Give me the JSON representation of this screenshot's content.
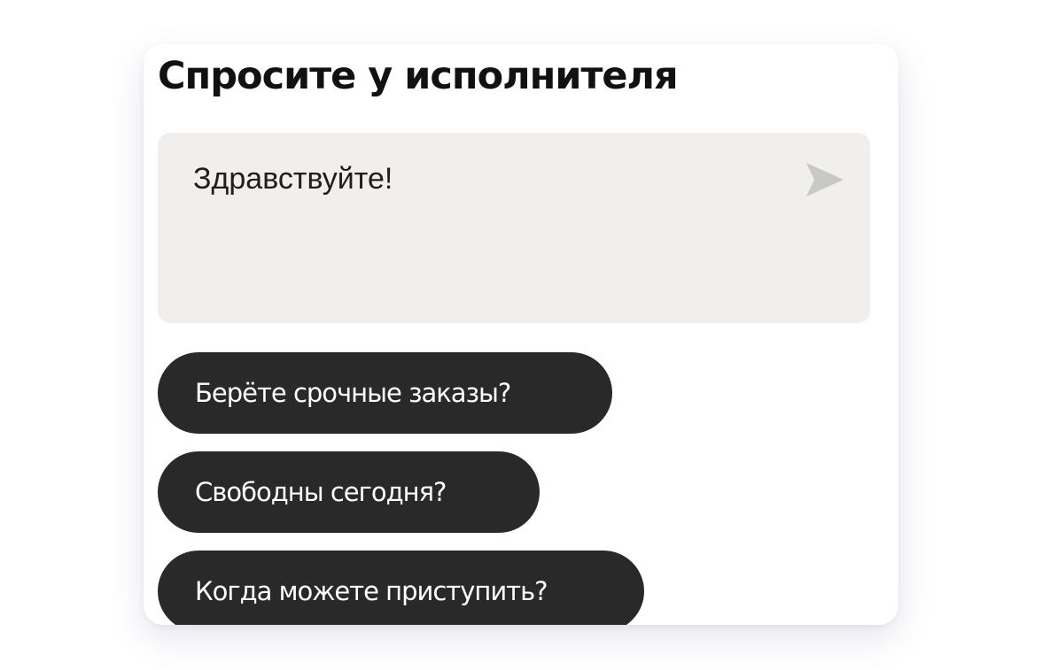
{
  "card": {
    "title": "Спросите у исполнителя"
  },
  "composer": {
    "message": "Здравствуйте!",
    "send_icon": "send-arrow-icon"
  },
  "quick_replies": [
    {
      "label": "Берёте срочные заказы?"
    },
    {
      "label": "Свободны сегодня?"
    },
    {
      "label": "Когда можете приступить?"
    }
  ],
  "colors": {
    "card_background": "#ffffff",
    "composer_background": "#f0efee",
    "chip_background": "#2a2929",
    "chip_text": "#ffffff",
    "send_icon": "#c8c8c6",
    "title_text": "#111111"
  }
}
